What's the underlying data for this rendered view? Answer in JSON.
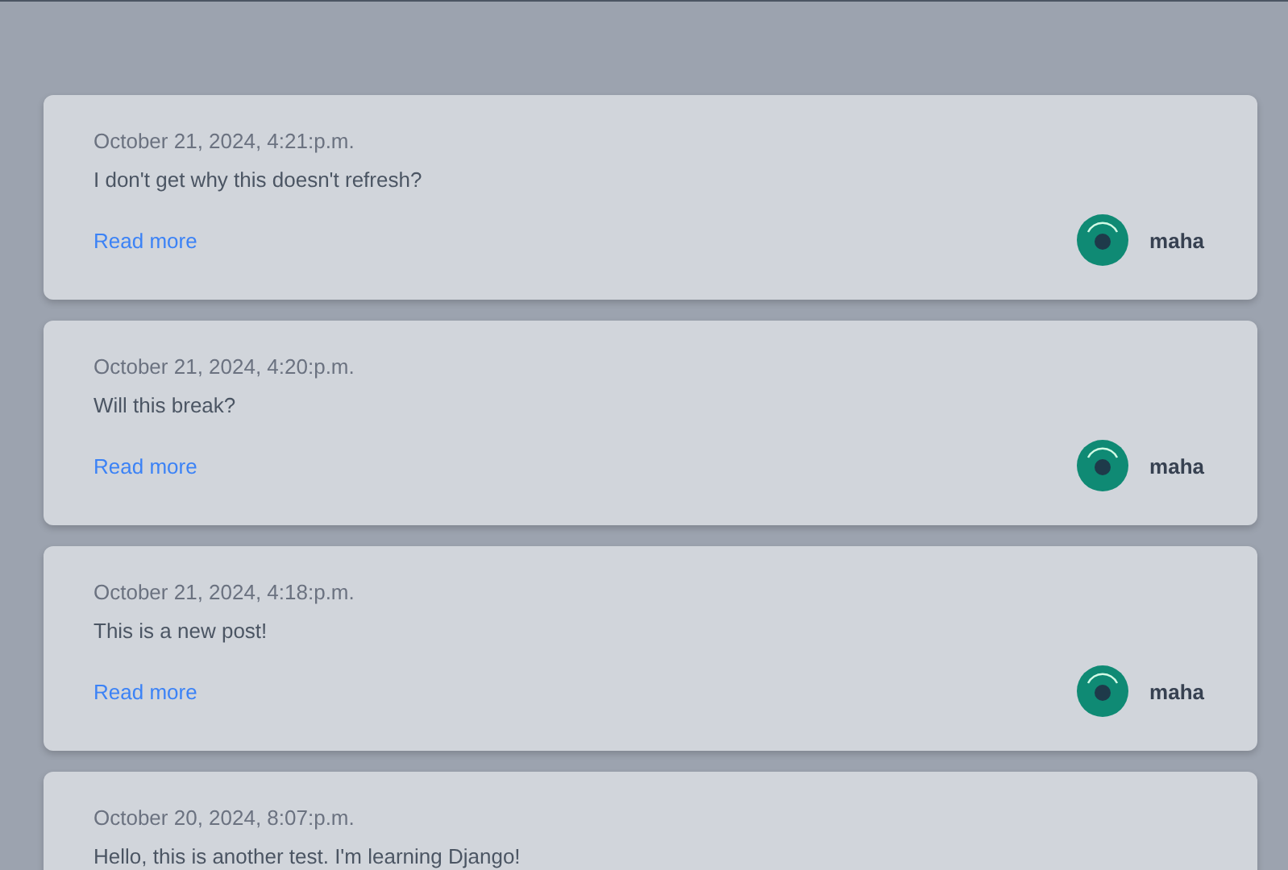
{
  "posts": [
    {
      "date": "October 21, 2024, 4:21:p.m.",
      "body": "I don't get why this doesn't refresh?",
      "link": "Read more",
      "author": "maha"
    },
    {
      "date": "October 21, 2024, 4:20:p.m.",
      "body": "Will this break?",
      "link": "Read more",
      "author": "maha"
    },
    {
      "date": "October 21, 2024, 4:18:p.m.",
      "body": "This is a new post!",
      "link": "Read more",
      "author": "maha"
    },
    {
      "date": "October 20, 2024, 8:07:p.m.",
      "body": "Hello, this is another test. I'm learning Django!"
    }
  ]
}
